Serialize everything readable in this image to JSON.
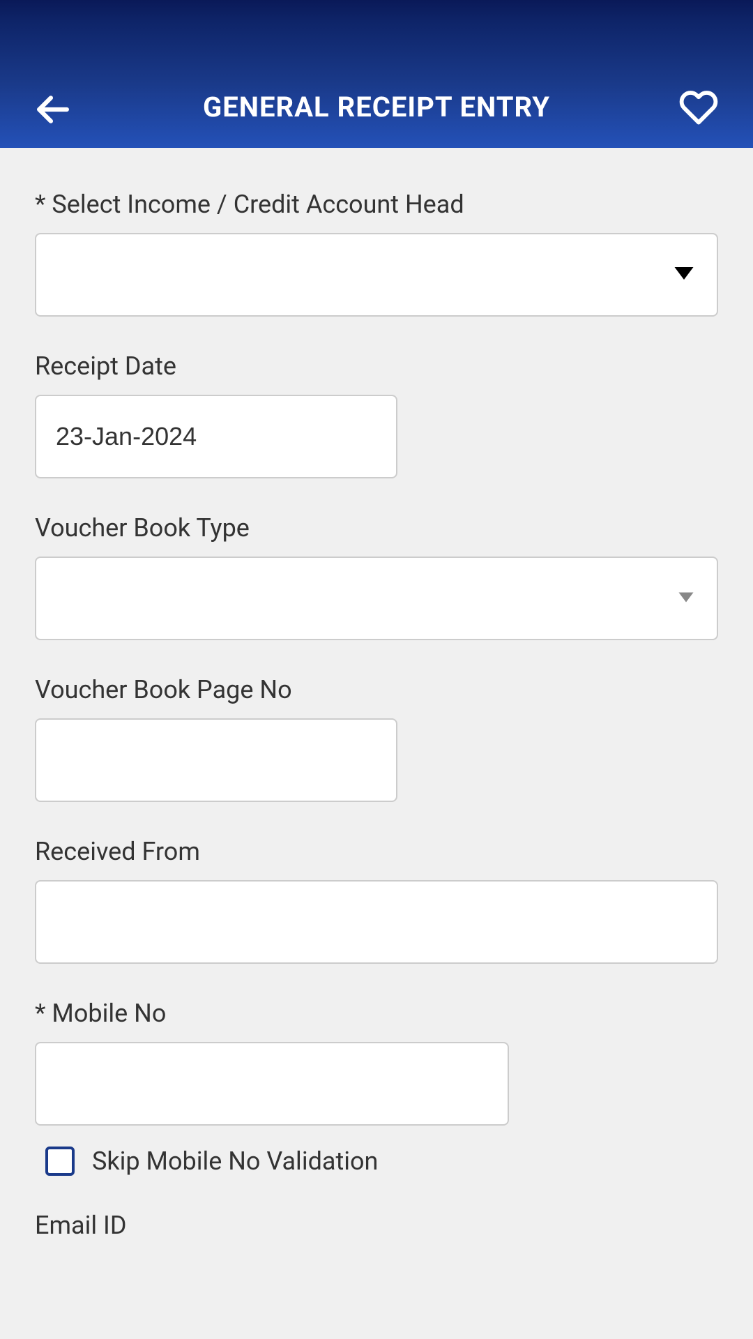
{
  "header": {
    "title": "GENERAL RECEIPT ENTRY"
  },
  "form": {
    "account_head": {
      "label": "* Select Income / Credit Account Head",
      "value": ""
    },
    "receipt_date": {
      "label": "Receipt Date",
      "value": "23-Jan-2024"
    },
    "voucher_book_type": {
      "label": "Voucher Book Type",
      "value": ""
    },
    "voucher_page_no": {
      "label": "Voucher Book Page No",
      "value": ""
    },
    "received_from": {
      "label": "Received From",
      "value": ""
    },
    "mobile_no": {
      "label": "* Mobile No",
      "value": ""
    },
    "skip_validation": {
      "label": "Skip Mobile No Validation",
      "checked": false
    },
    "email": {
      "label": "Email ID",
      "value": ""
    }
  }
}
